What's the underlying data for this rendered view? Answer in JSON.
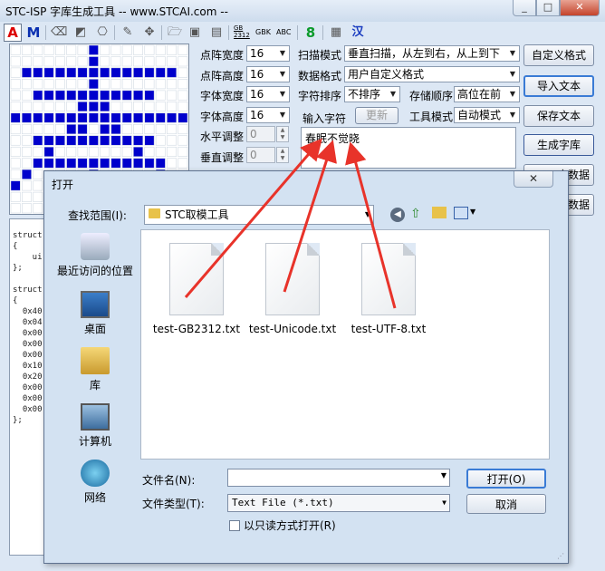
{
  "window": {
    "title": "STC-ISP 字库生成工具 -- www.STCAI.com --"
  },
  "toolbar": {
    "a_label": "A",
    "m_label": "M",
    "gb_label": "GB\n2312",
    "gbk_label": "GBK",
    "abc_label": "ABC",
    "eight_label": "8",
    "han_label": "汉"
  },
  "settings": {
    "matrix_width_label": "点阵宽度",
    "matrix_width": "16",
    "matrix_height_label": "点阵高度",
    "matrix_height": "16",
    "font_width_label": "字体宽度",
    "font_width": "16",
    "font_height_label": "字体高度",
    "font_height": "16",
    "h_adjust_label": "水平调整",
    "h_adjust": "0",
    "v_adjust_label": "垂直调整",
    "v_adjust": "0",
    "scan_mode_label": "扫描模式",
    "scan_mode": "垂直扫描，从左到右，从上到下",
    "data_format_label": "数据格式",
    "data_format": "用户自定义格式",
    "char_sort_label": "字符排序",
    "char_sort": "不排序",
    "storage_order_label": "存储顺序",
    "storage_order": "高位在前",
    "input_char_label": "输入字符",
    "update_label": "更新",
    "tool_mode_label": "工具模式",
    "tool_mode": "自动模式",
    "input_text": "春眠不觉晓"
  },
  "buttons": {
    "custom_format": "自定义格式",
    "import_text": "导入文本",
    "save_text": "保存文本",
    "generate_font": "生成字库",
    "lib_data_1": "库数据",
    "lib_data_2": "库数据"
  },
  "code_text": "struct\n{\n    ui\n};\n\nstruct\n{\n  0x40\n  0x04\n  0x00\n  0x00\n  0x00\n  0x10\n  0x20\n  0x00\n  0x00\n  0x00\n};",
  "dialog": {
    "title": "打开",
    "lookin_label": "查找范围(I):",
    "lookin_value": "STC取模工具",
    "places": [
      {
        "label": "最近访问的位置",
        "icon": "recent-places-icon"
      },
      {
        "label": "桌面",
        "icon": "desktop-icon"
      },
      {
        "label": "库",
        "icon": "libraries-icon"
      },
      {
        "label": "计算机",
        "icon": "computer-icon"
      },
      {
        "label": "网络",
        "icon": "network-icon"
      }
    ],
    "files": [
      {
        "name": "test-GB2312.txt"
      },
      {
        "name": "test-Unicode.txt"
      },
      {
        "name": "test-UTF-8.txt"
      }
    ],
    "filename_label": "文件名(N):",
    "filename_value": "",
    "filetype_label": "文件类型(T):",
    "filetype_value": "Text File (*.txt)",
    "readonly_label": "以只读方式打开(R)",
    "open_label": "打开(O)",
    "cancel_label": "取消"
  },
  "colors": {
    "grid_on": "#0000cc",
    "annotation_arrow": "#e8332a"
  }
}
